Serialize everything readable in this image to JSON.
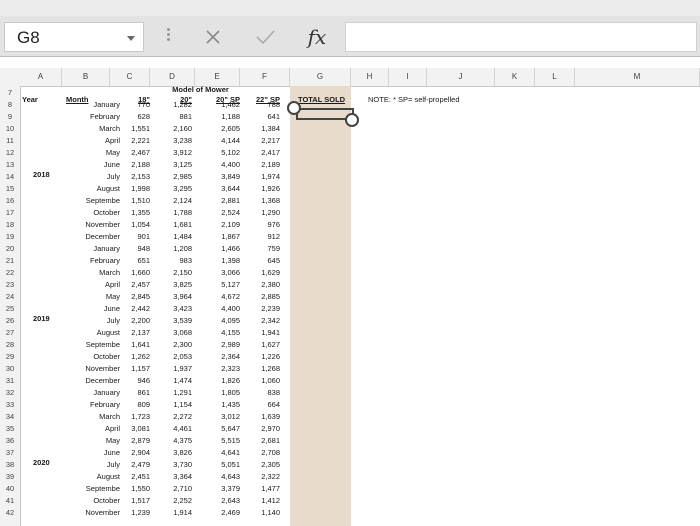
{
  "name_box": {
    "value": "G8"
  },
  "toolbar": {
    "fx_label": "fx"
  },
  "columns": [
    "A",
    "B",
    "C",
    "D",
    "E",
    "F",
    "G",
    "H",
    "I",
    "J",
    "K",
    "L",
    "M"
  ],
  "row_numbers": [
    "7",
    "8",
    "9",
    "10",
    "11",
    "12",
    "13",
    "14",
    "15",
    "16",
    "17",
    "18",
    "19",
    "20",
    "21",
    "22",
    "23",
    "24",
    "25",
    "26",
    "27",
    "28",
    "29",
    "30",
    "31",
    "32",
    "33",
    "34",
    "35",
    "36",
    "37",
    "38",
    "39",
    "40",
    "41",
    "42"
  ],
  "sheet": {
    "model_header": "Model of Mower",
    "year_header": "Year",
    "month_header": "Month",
    "col_18": "18\"",
    "col_20": "20\"",
    "col_20sp": "20\" SP",
    "col_22sp": "22\" SP",
    "total_sold": "TOTAL SOLD",
    "note": "NOTE:  * SP= self-propelled",
    "years": [
      {
        "label": "2018"
      },
      {
        "label": "2019"
      },
      {
        "label": "2020"
      }
    ],
    "rows": [
      {
        "month": "January",
        "v18": "770",
        "v20": "1,282",
        "v20sp": "1,462",
        "v22sp": "788"
      },
      {
        "month": "February",
        "v18": "628",
        "v20": "881",
        "v20sp": "1,188",
        "v22sp": "641"
      },
      {
        "month": "March",
        "v18": "1,551",
        "v20": "2,160",
        "v20sp": "2,605",
        "v22sp": "1,384"
      },
      {
        "month": "April",
        "v18": "2,221",
        "v20": "3,238",
        "v20sp": "4,144",
        "v22sp": "2,217"
      },
      {
        "month": "May",
        "v18": "2,467",
        "v20": "3,912",
        "v20sp": "5,102",
        "v22sp": "2,417"
      },
      {
        "month": "June",
        "v18": "2,188",
        "v20": "3,125",
        "v20sp": "4,400",
        "v22sp": "2,189"
      },
      {
        "month": "July",
        "v18": "2,153",
        "v20": "2,985",
        "v20sp": "3,849",
        "v22sp": "1,974"
      },
      {
        "month": "August",
        "v18": "1,998",
        "v20": "3,295",
        "v20sp": "3,644",
        "v22sp": "1,926"
      },
      {
        "month": "Septembe",
        "v18": "1,510",
        "v20": "2,124",
        "v20sp": "2,881",
        "v22sp": "1,368"
      },
      {
        "month": "October",
        "v18": "1,355",
        "v20": "1,788",
        "v20sp": "2,524",
        "v22sp": "1,290"
      },
      {
        "month": "November",
        "v18": "1,054",
        "v20": "1,681",
        "v20sp": "2,109",
        "v22sp": "976"
      },
      {
        "month": "December",
        "v18": "901",
        "v20": "1,484",
        "v20sp": "1,867",
        "v22sp": "912"
      },
      {
        "month": "January",
        "v18": "948",
        "v20": "1,208",
        "v20sp": "1,466",
        "v22sp": "759"
      },
      {
        "month": "February",
        "v18": "651",
        "v20": "983",
        "v20sp": "1,398",
        "v22sp": "645"
      },
      {
        "month": "March",
        "v18": "1,660",
        "v20": "2,150",
        "v20sp": "3,066",
        "v22sp": "1,629"
      },
      {
        "month": "April",
        "v18": "2,457",
        "v20": "3,825",
        "v20sp": "5,127",
        "v22sp": "2,380"
      },
      {
        "month": "May",
        "v18": "2,845",
        "v20": "3,964",
        "v20sp": "4,672",
        "v22sp": "2,885"
      },
      {
        "month": "June",
        "v18": "2,442",
        "v20": "3,423",
        "v20sp": "4,400",
        "v22sp": "2,239"
      },
      {
        "month": "July",
        "v18": "2,200",
        "v20": "3,539",
        "v20sp": "4,095",
        "v22sp": "2,342"
      },
      {
        "month": "August",
        "v18": "2,137",
        "v20": "3,068",
        "v20sp": "4,155",
        "v22sp": "1,941"
      },
      {
        "month": "Septembe",
        "v18": "1,641",
        "v20": "2,300",
        "v20sp": "2,989",
        "v22sp": "1,627"
      },
      {
        "month": "October",
        "v18": "1,262",
        "v20": "2,053",
        "v20sp": "2,364",
        "v22sp": "1,226"
      },
      {
        "month": "November",
        "v18": "1,157",
        "v20": "1,937",
        "v20sp": "2,323",
        "v22sp": "1,268"
      },
      {
        "month": "December",
        "v18": "946",
        "v20": "1,474",
        "v20sp": "1,826",
        "v22sp": "1,060"
      },
      {
        "month": "January",
        "v18": "861",
        "v20": "1,291",
        "v20sp": "1,805",
        "v22sp": "838"
      },
      {
        "month": "February",
        "v18": "809",
        "v20": "1,154",
        "v20sp": "1,435",
        "v22sp": "664"
      },
      {
        "month": "March",
        "v18": "1,723",
        "v20": "2,272",
        "v20sp": "3,012",
        "v22sp": "1,639"
      },
      {
        "month": "April",
        "v18": "3,081",
        "v20": "4,461",
        "v20sp": "5,647",
        "v22sp": "2,970"
      },
      {
        "month": "May",
        "v18": "2,879",
        "v20": "4,375",
        "v20sp": "5,515",
        "v22sp": "2,681"
      },
      {
        "month": "June",
        "v18": "2,904",
        "v20": "3,826",
        "v20sp": "4,641",
        "v22sp": "2,708"
      },
      {
        "month": "July",
        "v18": "2,479",
        "v20": "3,730",
        "v20sp": "5,051",
        "v22sp": "2,305"
      },
      {
        "month": "August",
        "v18": "2,451",
        "v20": "3,364",
        "v20sp": "4,643",
        "v22sp": "2,322"
      },
      {
        "month": "Septembe",
        "v18": "1,550",
        "v20": "2,710",
        "v20sp": "3,379",
        "v22sp": "1,477"
      },
      {
        "month": "October",
        "v18": "1,517",
        "v20": "2,252",
        "v20sp": "2,643",
        "v22sp": "1,412"
      },
      {
        "month": "November",
        "v18": "1,239",
        "v20": "1,914",
        "v20sp": "2,469",
        "v22sp": "1,140"
      }
    ]
  }
}
